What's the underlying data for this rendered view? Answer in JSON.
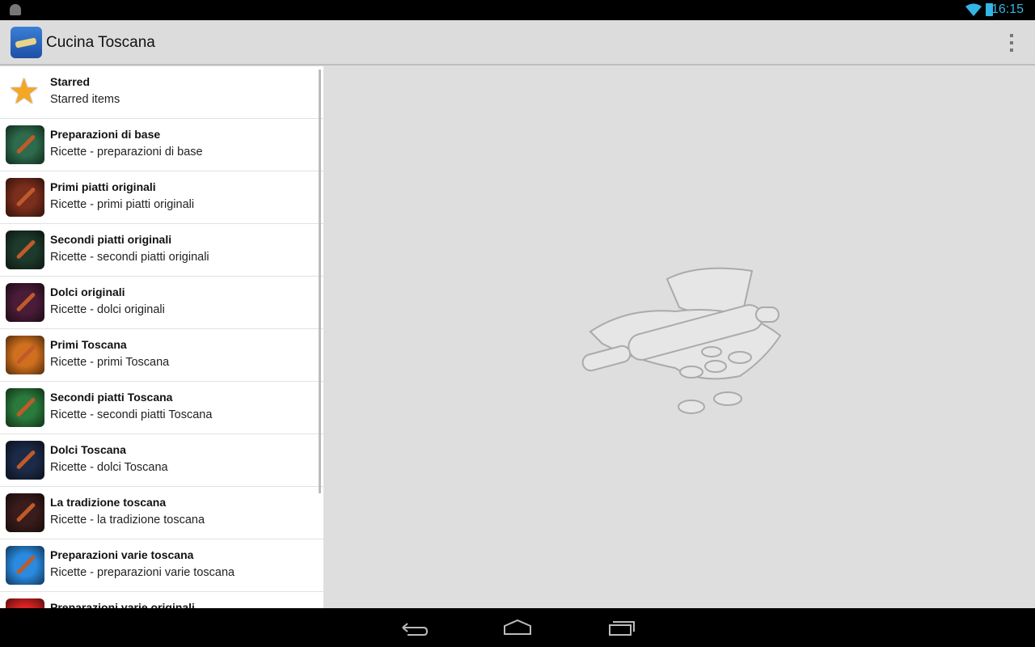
{
  "status_bar": {
    "time": "16:15"
  },
  "action_bar": {
    "title": "Cucina Toscana"
  },
  "list": {
    "items": [
      {
        "title": "Starred",
        "subtitle": "Starred items",
        "icon": "star-icon",
        "color": ""
      },
      {
        "title": "Preparazioni di base",
        "subtitle": "Ricette - preparazioni di base",
        "icon": "ladle-icon",
        "color": "#2d6b4c"
      },
      {
        "title": "Primi piatti originali",
        "subtitle": "Ricette - primi piatti originali",
        "icon": "colander-icon",
        "color": "#7a2e1c"
      },
      {
        "title": "Secondi piatti originali",
        "subtitle": "Ricette - secondi piatti originali",
        "icon": "spoon-icon",
        "color": "#1e3a2c"
      },
      {
        "title": "Dolci originali",
        "subtitle": "Ricette - dolci originali",
        "icon": "rolling-pin-icon",
        "color": "#4a1c38"
      },
      {
        "title": "Primi Toscana",
        "subtitle": "Ricette - primi Toscana",
        "icon": "ladle-icon",
        "color": "#d0701e"
      },
      {
        "title": "Secondi piatti Toscana",
        "subtitle": "Ricette - secondi piatti Toscana",
        "icon": "colander-icon",
        "color": "#2a7a3c"
      },
      {
        "title": "Dolci Toscana",
        "subtitle": "Ricette - dolci Toscana",
        "icon": "spoon-icon",
        "color": "#1c2a48"
      },
      {
        "title": "La tradizione toscana",
        "subtitle": "Ricette - la tradizione toscana",
        "icon": "colander-icon",
        "color": "#3a1c1c"
      },
      {
        "title": "Preparazioni varie toscana",
        "subtitle": "Ricette - preparazioni varie toscana",
        "icon": "rolling-pin-icon",
        "color": "#2a8ae0"
      },
      {
        "title": "Preparazioni varie originali",
        "subtitle": "",
        "icon": "rolling-pin-icon",
        "color": "#e02424"
      }
    ]
  }
}
